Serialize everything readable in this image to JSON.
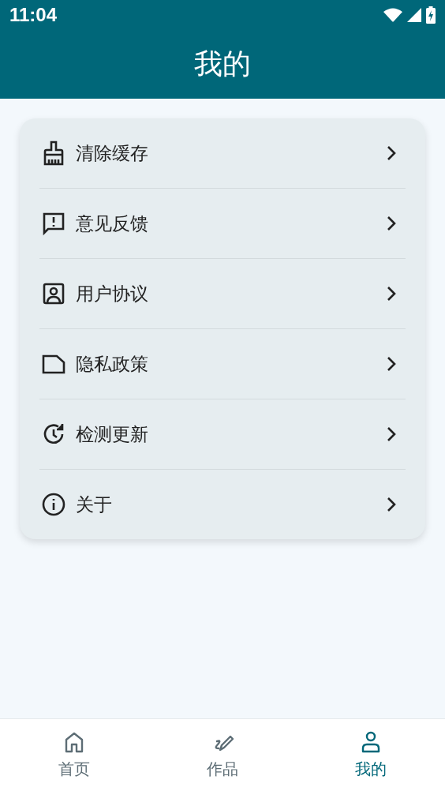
{
  "status_bar": {
    "time": "11:04"
  },
  "header": {
    "title": "我的"
  },
  "menu": [
    {
      "label": "清除缓存"
    },
    {
      "label": "意见反馈"
    },
    {
      "label": "用户协议"
    },
    {
      "label": "隐私政策"
    },
    {
      "label": "检测更新"
    },
    {
      "label": "关于"
    }
  ],
  "tabs": [
    {
      "label": "首页",
      "selected": false
    },
    {
      "label": "作品",
      "selected": false
    },
    {
      "label": "我的",
      "selected": true
    }
  ]
}
